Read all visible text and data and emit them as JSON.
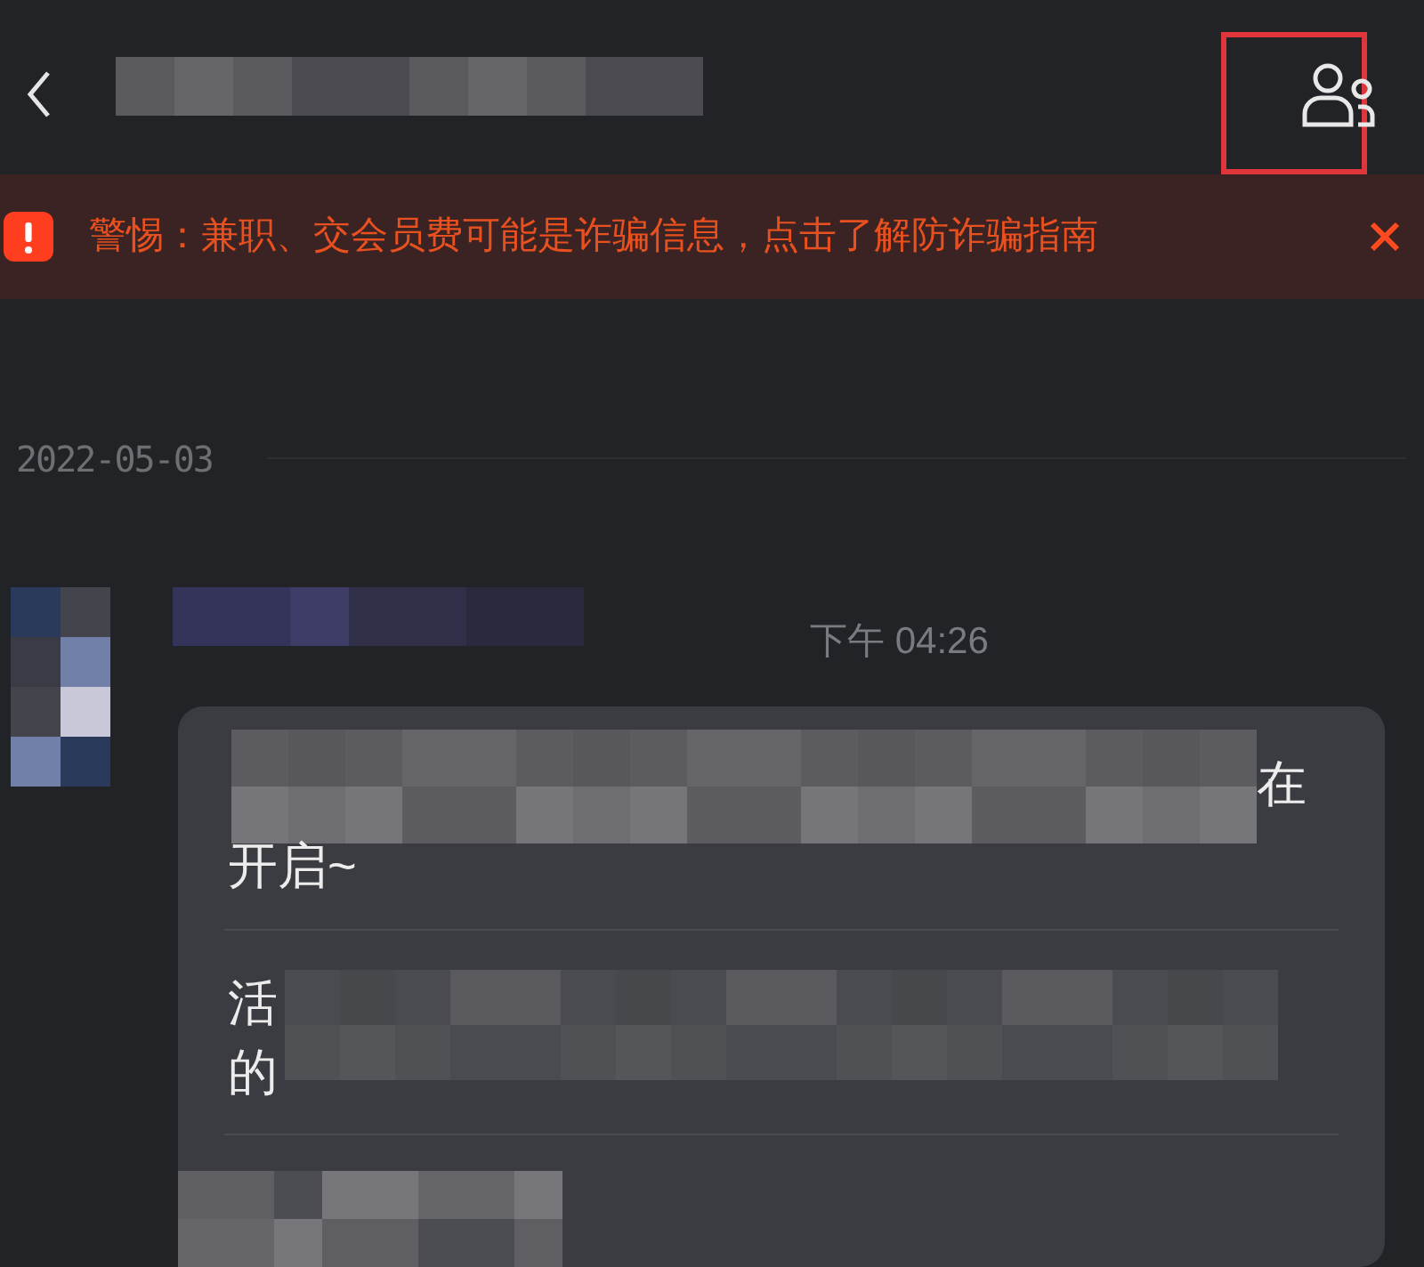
{
  "header": {
    "highlighted": true
  },
  "warning_banner": {
    "text": "警惕：兼职、交会员费可能是诈骗信息，点击了解防诈骗指南"
  },
  "date_divider": "2022-05-03",
  "message": {
    "time": "下午 04:26",
    "lines": [
      "在",
      "开启~"
    ],
    "sections": [
      "活",
      "的"
    ]
  }
}
